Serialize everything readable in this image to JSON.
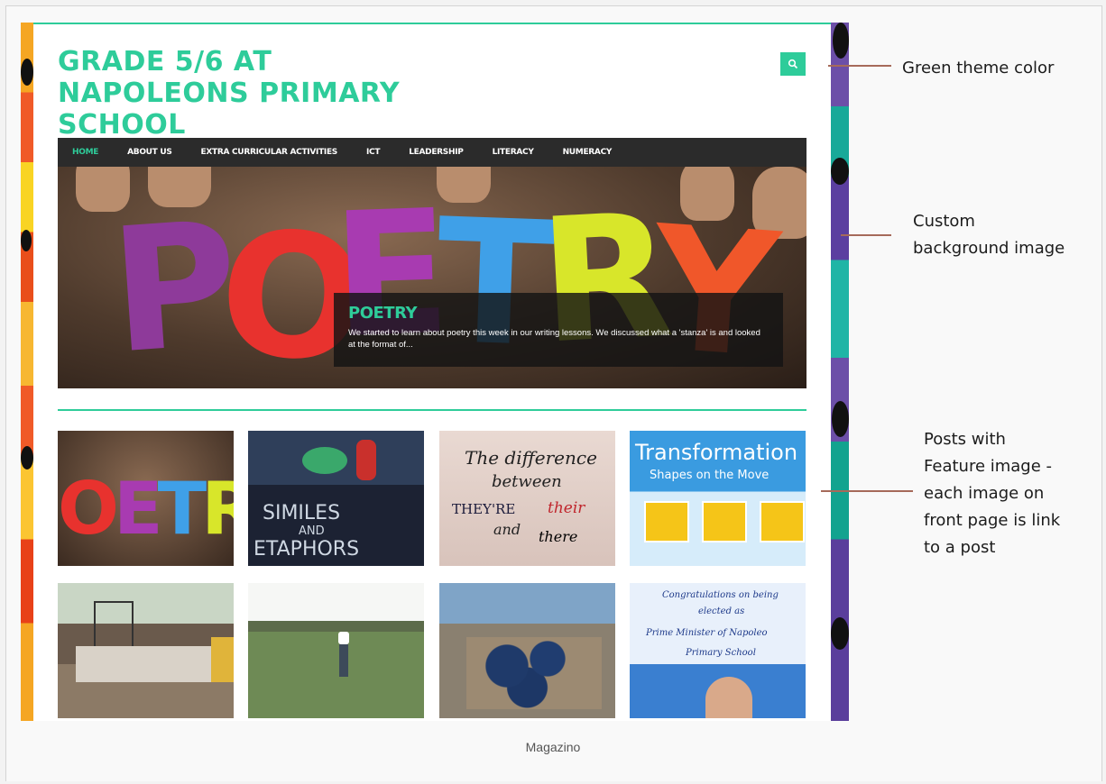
{
  "site": {
    "title": "GRADE 5/6 AT NAPOLEONS PRIMARY SCHOOL",
    "accent_color": "#2ecc9a"
  },
  "header": {
    "search_icon": "search-icon"
  },
  "nav": {
    "items": [
      {
        "label": "HOME",
        "active": true
      },
      {
        "label": "ABOUT US",
        "active": false
      },
      {
        "label": "EXTRA CURRICULAR ACTIVITIES",
        "active": false
      },
      {
        "label": "ICT",
        "active": false
      },
      {
        "label": "LEADERSHIP",
        "active": false
      },
      {
        "label": "LITERACY",
        "active": false
      },
      {
        "label": "NUMERACY",
        "active": false
      }
    ]
  },
  "hero": {
    "image_text": "POETRY",
    "caption_title": "POETRY",
    "caption_text": "We started to learn about poetry this week in our writing lessons. We discussed what a 'stanza' is and looked at the format of..."
  },
  "thumbnails": [
    {
      "image_text": "OETR"
    },
    {
      "image_text_line1": "SIMILES",
      "image_text_line2": "AND",
      "image_text_line3": "ETAPHORS"
    },
    {
      "line1": "The difference",
      "line2": "between",
      "line3a": "THEY'RE",
      "line3b": "their",
      "line4a": "and",
      "line4b": "there"
    },
    {
      "heading": "Transformation",
      "subheading": "Shapes on the Move"
    },
    {
      "image": "classroom desk photo"
    },
    {
      "image": "field photo"
    },
    {
      "image": "class group photo"
    },
    {
      "line1": "Congratulations on being",
      "line2": "elected as",
      "line3": "Prime Minister of Napoleo",
      "line4": "Primary School"
    }
  ],
  "annotations": {
    "theme_color": "Green theme color",
    "background_image_line1": "Custom",
    "background_image_line2": "background image",
    "posts_line1": "Posts with",
    "posts_line2": "Feature image -",
    "posts_line3": "each image on",
    "posts_line4": "front page is link",
    "posts_line5": "to a post"
  },
  "figure_caption": "Magazino"
}
